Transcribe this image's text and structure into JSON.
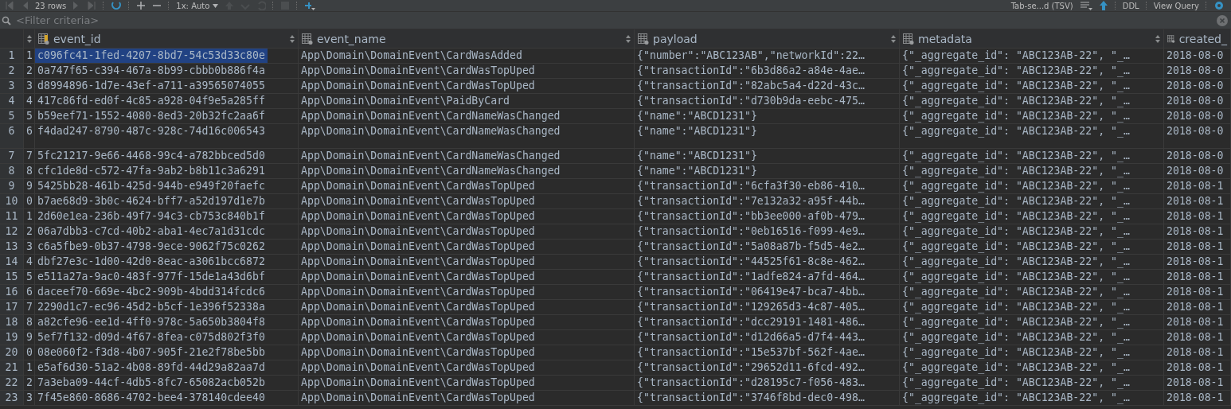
{
  "toolbar": {
    "row_count": "23 rows",
    "transaction_mode": "1x: Auto",
    "export_format": "Tab-se...d (TSV)",
    "ddl": "DDL",
    "view_query": "View Query"
  },
  "filter": {
    "placeholder": "<Filter criteria>"
  },
  "table": {
    "columns": [
      {
        "name": "event_id",
        "key": true
      },
      {
        "name": "event_name",
        "key": false
      },
      {
        "name": "payload",
        "key": false
      },
      {
        "name": "metadata",
        "key": false
      },
      {
        "name": "created_",
        "key": false
      }
    ],
    "rows": [
      {
        "row": "1",
        "index": "1",
        "event_id": "c096fc41-1fed-4207-8bd7-54c53d33c80e",
        "event_name": "App\\Domain\\DomainEvent\\CardWasAdded",
        "payload": "{\"number\":\"ABC123AB\",\"networkId\":22…",
        "metadata": "{\"_aggregate_id\": \"ABC123AB-22\", \"_…",
        "created": "2018-08-0",
        "selected": true,
        "expanded": false
      },
      {
        "row": "2",
        "index": "2",
        "event_id": "0a747f65-c394-467a-8b99-cbbb0b886f4a",
        "event_name": "App\\Domain\\DomainEvent\\CardWasTopUped",
        "payload": "{\"transactionId\":\"6b3d86a2-a84e-4ae…",
        "metadata": "{\"_aggregate_id\": \"ABC123AB-22\", \"_…",
        "created": "2018-08-0",
        "selected": false,
        "expanded": false
      },
      {
        "row": "3",
        "index": "3",
        "event_id": "d8994896-1d7e-43ef-a711-a39565074055",
        "event_name": "App\\Domain\\DomainEvent\\CardWasTopUped",
        "payload": "{\"transactionId\":\"82abc5a4-d22d-43c…",
        "metadata": "{\"_aggregate_id\": \"ABC123AB-22\", \"_…",
        "created": "2018-08-0",
        "selected": false,
        "expanded": false
      },
      {
        "row": "4",
        "index": "4",
        "event_id": "417c86fd-ed0f-4c85-a928-04f9e5a285ff",
        "event_name": "App\\Domain\\DomainEvent\\PaidByCard",
        "payload": "{\"transactionId\":\"d730b9da-eebc-475…",
        "metadata": "{\"_aggregate_id\": \"ABC123AB-22\", \"_…",
        "created": "2018-08-0",
        "selected": false,
        "expanded": false
      },
      {
        "row": "5",
        "index": "5",
        "event_id": "b59eef71-1552-4080-8ed3-20b32fc2aa6f",
        "event_name": "App\\Domain\\DomainEvent\\CardNameWasChanged",
        "payload": "{\"name\":\"ABCD1231\"}",
        "metadata": "{\"_aggregate_id\": \"ABC123AB-22\", \"_…",
        "created": "2018-08-0",
        "selected": false,
        "expanded": false
      },
      {
        "row": "6",
        "index": "6",
        "event_id": "f4dad247-8790-487c-928c-74d16c006543",
        "event_name": "App\\Domain\\DomainEvent\\CardNameWasChanged",
        "payload": "{\"name\":\"ABCD1231\"}",
        "metadata": "{\"_aggregate_id\": \"ABC123AB-22\", \"_…",
        "created": "2018-08-0",
        "selected": false,
        "expanded": true
      },
      {
        "row": "7",
        "index": "7",
        "event_id": "5fc21217-9e66-4468-99c4-a782bbced5d0",
        "event_name": "App\\Domain\\DomainEvent\\CardNameWasChanged",
        "payload": "{\"name\":\"ABCD1231\"}",
        "metadata": "{\"_aggregate_id\": \"ABC123AB-22\", \"_…",
        "created": "2018-08-0",
        "selected": false,
        "expanded": false
      },
      {
        "row": "8",
        "index": "8",
        "event_id": "cfc1de8d-c572-47fa-9ab2-b8b11c3a6291",
        "event_name": "App\\Domain\\DomainEvent\\CardNameWasChanged",
        "payload": "{\"name\":\"ABCD1231\"}",
        "metadata": "{\"_aggregate_id\": \"ABC123AB-22\", \"_…",
        "created": "2018-08-0",
        "selected": false,
        "expanded": false
      },
      {
        "row": "9",
        "index": "9",
        "event_id": "5425bb28-461b-425d-944b-e949f20faefc",
        "event_name": "App\\Domain\\DomainEvent\\CardWasTopUped",
        "payload": "{\"transactionId\":\"6cfa3f30-eb86-410…",
        "metadata": "{\"_aggregate_id\": \"ABC123AB-22\", \"_…",
        "created": "2018-08-1",
        "selected": false,
        "expanded": false
      },
      {
        "row": "10",
        "index": "0",
        "event_id": "b7ae68d9-3b0c-4624-bff7-a52d197d1e7b",
        "event_name": "App\\Domain\\DomainEvent\\CardWasTopUped",
        "payload": "{\"transactionId\":\"7e132a32-a95f-44b…",
        "metadata": "{\"_aggregate_id\": \"ABC123AB-22\", \"_…",
        "created": "2018-08-1",
        "selected": false,
        "expanded": false
      },
      {
        "row": "11",
        "index": "1",
        "event_id": "2d60e1ea-236b-49f7-94c3-cb753c840b1f",
        "event_name": "App\\Domain\\DomainEvent\\CardWasTopUped",
        "payload": "{\"transactionId\":\"bb3ee000-af0b-479…",
        "metadata": "{\"_aggregate_id\": \"ABC123AB-22\", \"_…",
        "created": "2018-08-1",
        "selected": false,
        "expanded": false
      },
      {
        "row": "12",
        "index": "2",
        "event_id": "06a7dbb3-c7cd-40b2-aba1-4ec7a1d31cdc",
        "event_name": "App\\Domain\\DomainEvent\\CardWasTopUped",
        "payload": "{\"transactionId\":\"0eb16516-f099-4e9…",
        "metadata": "{\"_aggregate_id\": \"ABC123AB-22\", \"_…",
        "created": "2018-08-1",
        "selected": false,
        "expanded": false
      },
      {
        "row": "13",
        "index": "3",
        "event_id": "c6a5fbe9-0b37-4798-9ece-9062f75c0262",
        "event_name": "App\\Domain\\DomainEvent\\CardWasTopUped",
        "payload": "{\"transactionId\":\"5a08a87b-f5d5-4e2…",
        "metadata": "{\"_aggregate_id\": \"ABC123AB-22\", \"_…",
        "created": "2018-08-1",
        "selected": false,
        "expanded": false
      },
      {
        "row": "14",
        "index": "4",
        "event_id": "dbf27e3c-1d00-42d0-8eac-a3061bcc6872",
        "event_name": "App\\Domain\\DomainEvent\\CardWasTopUped",
        "payload": "{\"transactionId\":\"44525f61-8c8e-462…",
        "metadata": "{\"_aggregate_id\": \"ABC123AB-22\", \"_…",
        "created": "2018-08-1",
        "selected": false,
        "expanded": false
      },
      {
        "row": "15",
        "index": "5",
        "event_id": "e511a27a-9ac0-483f-977f-15de1a43d6bf",
        "event_name": "App\\Domain\\DomainEvent\\CardWasTopUped",
        "payload": "{\"transactionId\":\"1adfe824-a7fd-464…",
        "metadata": "{\"_aggregate_id\": \"ABC123AB-22\", \"_…",
        "created": "2018-08-1",
        "selected": false,
        "expanded": false
      },
      {
        "row": "16",
        "index": "6",
        "event_id": "daceef70-669e-4bc2-909b-4bdd314fcdc6",
        "event_name": "App\\Domain\\DomainEvent\\CardWasTopUped",
        "payload": "{\"transactionId\":\"06419e47-bca7-4bb…",
        "metadata": "{\"_aggregate_id\": \"ABC123AB-22\", \"_…",
        "created": "2018-08-1",
        "selected": false,
        "expanded": false
      },
      {
        "row": "17",
        "index": "7",
        "event_id": "2290d1c7-ec96-45d2-b5cf-1e396f52338a",
        "event_name": "App\\Domain\\DomainEvent\\CardWasTopUped",
        "payload": "{\"transactionId\":\"129265d3-4c87-405…",
        "metadata": "{\"_aggregate_id\": \"ABC123AB-22\", \"_…",
        "created": "2018-08-1",
        "selected": false,
        "expanded": false
      },
      {
        "row": "18",
        "index": "8",
        "event_id": "a82cfe96-ee1d-4ff0-978c-5a650b3804f8",
        "event_name": "App\\Domain\\DomainEvent\\CardWasTopUped",
        "payload": "{\"transactionId\":\"dcc29191-1481-486…",
        "metadata": "{\"_aggregate_id\": \"ABC123AB-22\", \"_…",
        "created": "2018-08-1",
        "selected": false,
        "expanded": false
      },
      {
        "row": "19",
        "index": "9",
        "event_id": "5ef7f132-d09d-4f67-8fea-c075d802f3f0",
        "event_name": "App\\Domain\\DomainEvent\\CardWasTopUped",
        "payload": "{\"transactionId\":\"d12d66a5-d7f4-443…",
        "metadata": "{\"_aggregate_id\": \"ABC123AB-22\", \"_…",
        "created": "2018-08-1",
        "selected": false,
        "expanded": false
      },
      {
        "row": "20",
        "index": "0",
        "event_id": "08e060f2-f3d8-4b07-905f-21e2f78be5bb",
        "event_name": "App\\Domain\\DomainEvent\\CardWasTopUped",
        "payload": "{\"transactionId\":\"15e537bf-562f-4ae…",
        "metadata": "{\"_aggregate_id\": \"ABC123AB-22\", \"_…",
        "created": "2018-08-1",
        "selected": false,
        "expanded": false
      },
      {
        "row": "21",
        "index": "1",
        "event_id": "e5af6d30-51a2-4b08-89fd-44d29a82aa7d",
        "event_name": "App\\Domain\\DomainEvent\\CardWasTopUped",
        "payload": "{\"transactionId\":\"29652d11-6fcd-492…",
        "metadata": "{\"_aggregate_id\": \"ABC123AB-22\", \"_…",
        "created": "2018-08-1",
        "selected": false,
        "expanded": false
      },
      {
        "row": "22",
        "index": "2",
        "event_id": "7a3eba09-44cf-4db5-8fc7-65082acb052b",
        "event_name": "App\\Domain\\DomainEvent\\CardWasTopUped",
        "payload": "{\"transactionId\":\"d28195c7-f056-483…",
        "metadata": "{\"_aggregate_id\": \"ABC123AB-22\", \"_…",
        "created": "2018-08-1",
        "selected": false,
        "expanded": false
      },
      {
        "row": "23",
        "index": "3",
        "event_id": "7f45e860-8686-4702-bee4-378140cdee40",
        "event_name": "App\\Domain\\DomainEvent\\CardWasTopUped",
        "payload": "{\"transactionId\":\"3746f8bd-dec0-498…",
        "metadata": "{\"_aggregate_id\": \"ABC123AB-22\", \"_…",
        "created": "2018-08-1",
        "selected": false,
        "expanded": false
      }
    ]
  }
}
